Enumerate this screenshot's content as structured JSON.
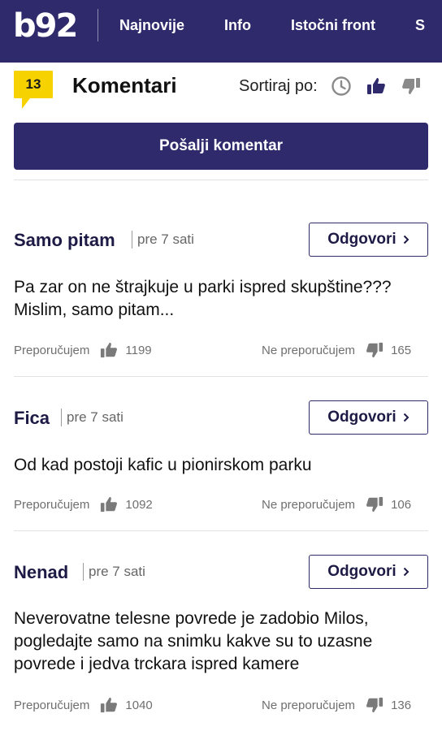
{
  "header": {
    "logo": "b92",
    "nav": [
      "Najnovije",
      "Info",
      "Istočni front",
      "S"
    ]
  },
  "comments_section": {
    "count": "13",
    "title": "Komentari",
    "sort_label": "Sortiraj po:",
    "sort_options": [
      "clock-icon",
      "thumbs-up-icon",
      "thumbs-down-icon"
    ],
    "submit_label": "Pošalji komentar"
  },
  "comments": [
    {
      "author": "Samo pitam",
      "time": "pre 7 sati",
      "reply": "Odgovori",
      "text": "Pa zar on ne štrajkuje u parki ispred skupštine??? Mislim, samo pitam...",
      "like_label": "Preporučujem",
      "likes": "1199",
      "dislike_label": "Ne preporučujem",
      "dislikes": "165"
    },
    {
      "author": "Fica",
      "time": "pre 7 sati",
      "reply": "Odgovori",
      "text": "Od kad postoji kafic u pionirskom parku",
      "like_label": "Preporučujem",
      "likes": "1092",
      "dislike_label": "Ne preporučujem",
      "dislikes": "106"
    },
    {
      "author": "Nenad",
      "time": "pre 7 sati",
      "reply": "Odgovori",
      "text": "Neverovatne telesne povrede je zadobio Milos, pogledajte samo na snimku kakve su to uzasne povrede i jedva trckara ispred kamere",
      "like_label": "Preporučujem",
      "likes": "1040",
      "dislike_label": "Ne preporučujem",
      "dislikes": "136"
    }
  ],
  "colors": {
    "brand": "#2e2a6b",
    "badge": "#f6d200"
  }
}
